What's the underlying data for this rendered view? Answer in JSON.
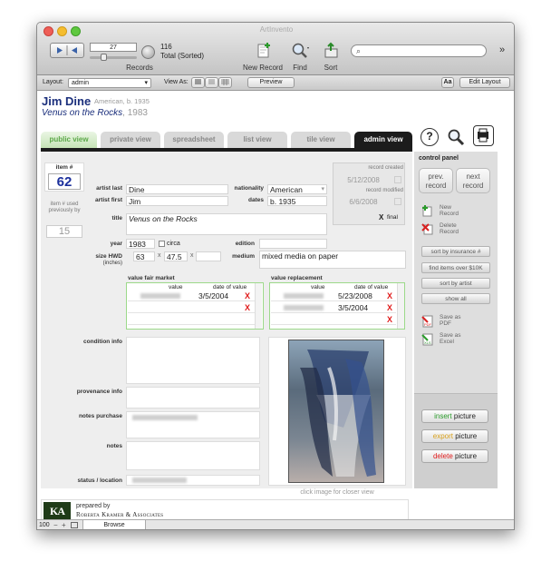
{
  "window": {
    "title": "ArtInvento"
  },
  "toolbar": {
    "record_number": "27",
    "records_label": "Records",
    "total": "116",
    "total_label": "Total (Sorted)",
    "new_record": "New Record",
    "find": "Find",
    "sort": "Sort",
    "search_placeholder": "",
    "more": "»"
  },
  "layoutbar": {
    "layout_label": "Layout:",
    "layout_value": "admin",
    "viewas_label": "View As:",
    "preview": "Preview",
    "aa": "Aa",
    "edit_layout": "Edit Layout"
  },
  "header": {
    "artist": "Jim Dine",
    "artist_meta": "American, b. 1935",
    "title": "Venus on the Rocks",
    "year": ", 1983"
  },
  "tabs": [
    "public view",
    "private view",
    "spreadsheet",
    "list view",
    "tile view",
    "admin view"
  ],
  "record": {
    "item_label": "item #",
    "item_no": "62",
    "used_label": "item # used previously by",
    "prev_no": "15"
  },
  "fields": {
    "artist_last_label": "artist last",
    "artist_last": "Dine",
    "artist_first_label": "artist first",
    "artist_first": "Jim",
    "title_label": "title",
    "title": "Venus on the Rocks",
    "year_label": "year",
    "year": "1983",
    "circa_label": "circa",
    "edition_label": "edition",
    "size_label": "size HWD",
    "size_unit": "(inches)",
    "h": "63",
    "w": "47.5",
    "x": "x",
    "medium_label": "medium",
    "medium": "mixed media on paper",
    "nationality_label": "nationality",
    "nationality": "American",
    "dates_label": "dates",
    "dates": "b. 1935"
  },
  "dates_box": {
    "created_label": "record created",
    "created": "5/12/2008",
    "modified_label": "record modified",
    "modified": "6/6/2008",
    "final_label": "final",
    "final_mark": "X"
  },
  "fair_market": {
    "label": "value fair market",
    "col_value": "value",
    "col_date": "date of value",
    "rows": [
      {
        "date": "3/5/2004",
        "del": "X"
      },
      {
        "date": "",
        "del": "X"
      }
    ]
  },
  "replacement": {
    "label": "value replacement",
    "col_value": "value",
    "col_date": "date of value",
    "rows": [
      {
        "date": "5/23/2008",
        "del": "X"
      },
      {
        "date": "3/5/2004",
        "del": "X"
      },
      {
        "date": "",
        "del": "X"
      }
    ]
  },
  "info": {
    "condition": "condition info",
    "provenance": "provenance info",
    "notes_purchase": "notes purchase",
    "notes": "notes",
    "status": "status / location"
  },
  "image": {
    "caption": "click image for closer view"
  },
  "control": {
    "title": "control panel",
    "prev": "prev. record",
    "next": "next record",
    "new": "New Record",
    "delete": "Delete Record",
    "sort_ins": "sort by insurance #",
    "find10k": "find items over $10K",
    "sort_artist": "sort by artist",
    "show_all": "show all",
    "save_pdf": "Save as PDF",
    "save_excel": "Save as Excel",
    "insert": "insert",
    "export": "export",
    "delete_pic": "delete",
    "picture": "picture",
    "help": "?",
    "pdf_tag": "PDF",
    "xls_tag": "XLS"
  },
  "footer": {
    "prepared": "prepared by",
    "company": "Roberta Kramer & Associates",
    "logo": "KA"
  },
  "statusbar": {
    "zoom": "100",
    "mode": "Browse"
  },
  "colors": {
    "accent_green": "#2c6e28",
    "tab_active": "#1c1c1c",
    "value_blue": "#1b2f9c",
    "delete_red": "#e01b1b"
  }
}
